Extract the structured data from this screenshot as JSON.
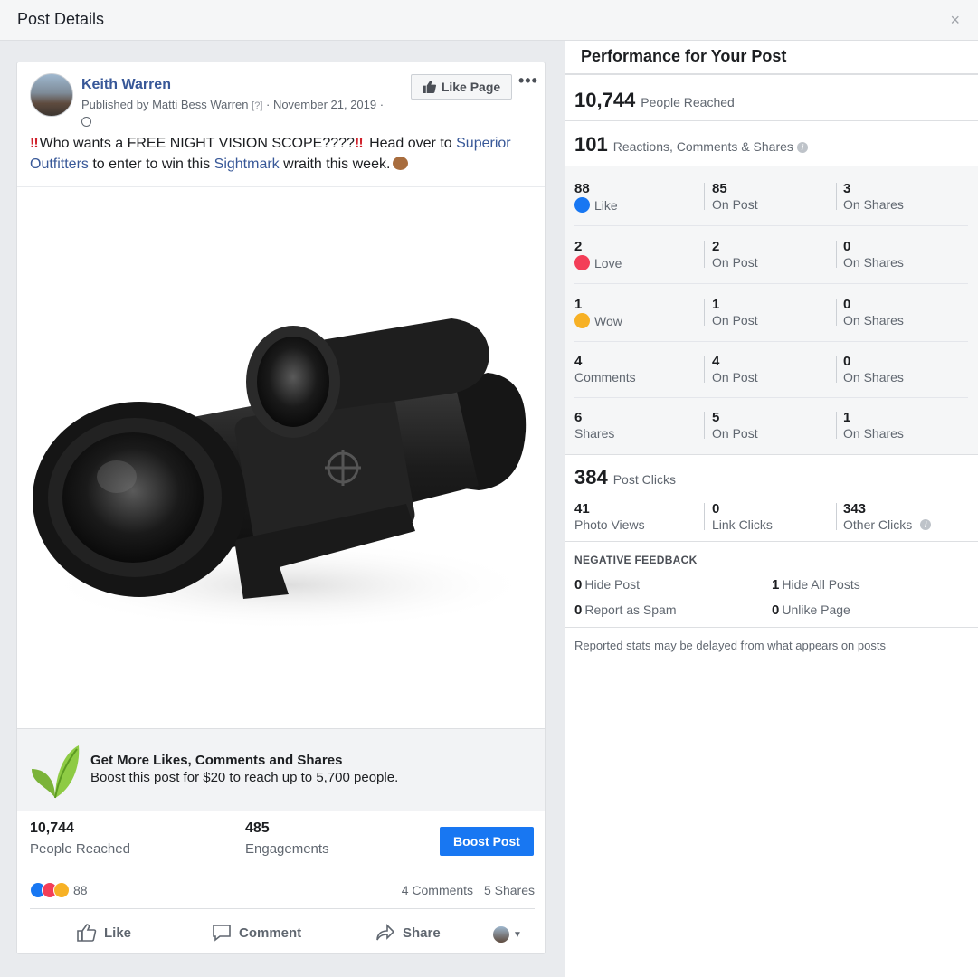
{
  "dialog": {
    "title": "Post Details",
    "close_glyph": "×"
  },
  "post": {
    "author": "Keith Warren",
    "published_prefix": "Published by",
    "publisher": "Matti Bess Warren",
    "help_marker": "[?]",
    "date": "November 21, 2019",
    "like_page_label": "Like Page",
    "more_glyph": "•••",
    "text_part1": "Who wants a FREE NIGHT VISION SCOPE????",
    "text_part2": "Head over to",
    "link1": "Superior Outfitters",
    "text_part3": "to enter to win this",
    "link2": "Sightmark",
    "text_part4": "wraith this week.",
    "bang_glyph": "‼",
    "boost_promo": {
      "title": "Get More Likes, Comments and Shares",
      "subtitle": "Boost this post for $20 to reach up to 5,700 people."
    },
    "stats": {
      "reached_value": "10,744",
      "reached_label": "People Reached",
      "engagements_value": "485",
      "engagements_label": "Engagements",
      "boost_button": "Boost Post"
    },
    "reactions_count": "88",
    "comments": "4 Comments",
    "shares": "5 Shares",
    "actions": {
      "like": "Like",
      "comment": "Comment",
      "share": "Share"
    }
  },
  "performance": {
    "title": "Performance for Your Post",
    "reached_value": "10,744",
    "reached_label": "People Reached",
    "engagement_value": "101",
    "engagement_label": "Reactions, Comments & Shares",
    "rows": [
      {
        "value": "88",
        "label": "Like",
        "icon": "like",
        "on_post": "85",
        "on_post_label": "On Post",
        "on_shares": "3",
        "on_shares_label": "On Shares"
      },
      {
        "value": "2",
        "label": "Love",
        "icon": "love",
        "on_post": "2",
        "on_post_label": "On Post",
        "on_shares": "0",
        "on_shares_label": "On Shares"
      },
      {
        "value": "1",
        "label": "Wow",
        "icon": "wow",
        "on_post": "1",
        "on_post_label": "On Post",
        "on_shares": "0",
        "on_shares_label": "On Shares"
      },
      {
        "value": "4",
        "label": "Comments",
        "icon": "",
        "on_post": "4",
        "on_post_label": "On Post",
        "on_shares": "0",
        "on_shares_label": "On Shares"
      },
      {
        "value": "6",
        "label": "Shares",
        "icon": "",
        "on_post": "5",
        "on_post_label": "On Post",
        "on_shares": "1",
        "on_shares_label": "On Shares"
      }
    ],
    "clicks_value": "384",
    "clicks_label": "Post Clicks",
    "photo_views_value": "41",
    "photo_views_label": "Photo Views",
    "link_clicks_value": "0",
    "link_clicks_label": "Link Clicks",
    "other_clicks_value": "343",
    "other_clicks_label": "Other Clicks",
    "negative_title": "NEGATIVE FEEDBACK",
    "negative": {
      "hide_post_value": "0",
      "hide_post_label": "Hide Post",
      "hide_all_value": "1",
      "hide_all_label": "Hide All Posts",
      "spam_value": "0",
      "spam_label": "Report as Spam",
      "unlike_value": "0",
      "unlike_label": "Unlike Page"
    },
    "footnote": "Reported stats may be delayed from what appears on posts"
  },
  "colors": {
    "facebook_blue": "#1877f2",
    "link_blue": "#385898",
    "love_red": "#f33e58",
    "wow_yellow": "#f7b125"
  }
}
